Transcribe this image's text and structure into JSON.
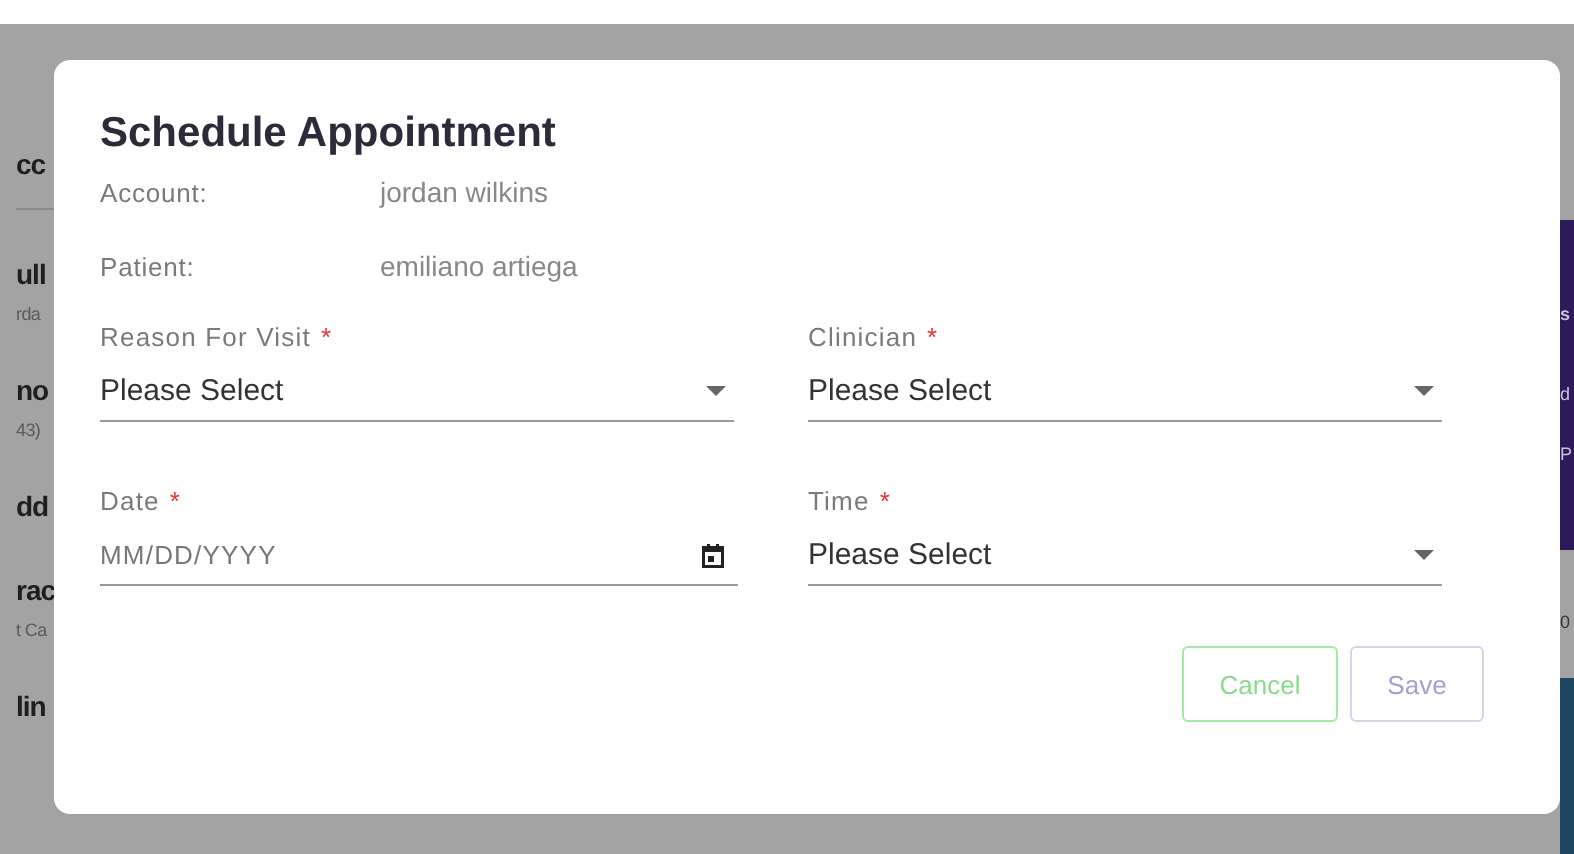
{
  "background": {
    "left_fragments": [
      {
        "text": "cc",
        "kind": "heading"
      },
      {
        "text": "ull",
        "kind": "heading"
      },
      {
        "text": "rda",
        "kind": "sub"
      },
      {
        "text": "no",
        "kind": "heading"
      },
      {
        "text": "43)",
        "kind": "sub"
      },
      {
        "text": "dd",
        "kind": "heading"
      },
      {
        "text": "rac",
        "kind": "heading"
      },
      {
        "text": "t Ca",
        "kind": "sub"
      },
      {
        "text": "lin",
        "kind": "heading"
      }
    ],
    "right_panel": [
      {
        "text": "s",
        "kind": "heading"
      },
      {
        "text": "d",
        "kind": "row"
      },
      {
        "text": "P",
        "kind": "row"
      }
    ],
    "right_value": "0"
  },
  "dialog": {
    "title": "Schedule Appointment",
    "info": [
      {
        "label": "Account:",
        "value": "jordan wilkins"
      },
      {
        "label": "Patient:",
        "value": "emiliano artiega"
      }
    ],
    "fields": [
      {
        "kind": "select",
        "label": "Reason For Visit",
        "required_mark": "*",
        "value": "Please Select"
      },
      {
        "kind": "select",
        "label": "Clinician",
        "required_mark": "*",
        "value": "Please Select"
      },
      {
        "kind": "date",
        "label": "Date",
        "required_mark": "*",
        "placeholder": "MM/DD/YYYY"
      },
      {
        "kind": "select",
        "label": "Time",
        "required_mark": "*",
        "value": "Please Select"
      }
    ],
    "buttons": [
      {
        "kind": "cancel",
        "label": "Cancel",
        "disabled": false
      },
      {
        "kind": "save",
        "label": "Save",
        "disabled": true
      }
    ]
  }
}
